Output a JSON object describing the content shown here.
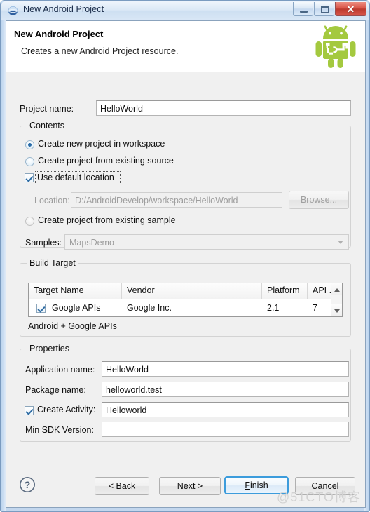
{
  "window": {
    "title": "New Android Project",
    "icon": "android-bubble-icon",
    "controls": {
      "minimize": "minimize-button",
      "restore": "restore-button",
      "close": "✕"
    }
  },
  "header": {
    "title": "New Android Project",
    "subtitle": "Creates a new Android Project resource.",
    "logo": "android-robot-logo",
    "logo_color": "#A4C93F"
  },
  "project_name": {
    "label": "Project name:",
    "value": "HelloWorld",
    "placeholder": ""
  },
  "contents": {
    "title": "Contents",
    "radio_new_workspace": {
      "label": "Create new project in workspace",
      "checked": true
    },
    "radio_existing_source": {
      "label": "Create project from existing source",
      "checked": false
    },
    "use_default_location": {
      "label": "Use default location",
      "checked": true,
      "focused": true
    },
    "location": {
      "label": "Location:",
      "value": "D:/AndroidDevelop/workspace/HelloWorld",
      "disabled": true
    },
    "browse_button": {
      "label": "Browse...",
      "disabled": true
    },
    "radio_existing_sample": {
      "label": "Create project from existing sample",
      "checked": false,
      "disabled": true
    },
    "samples": {
      "label": "Samples:",
      "value": "MapsDemo",
      "disabled": true
    }
  },
  "build_target": {
    "title": "Build Target",
    "columns": [
      "Target Name",
      "Vendor",
      "Platform",
      "API ..."
    ],
    "rows": [
      {
        "checked": true,
        "target_name": "Google APIs",
        "vendor": "Google Inc.",
        "platform": "2.1",
        "api_level": "7"
      }
    ],
    "description": "Android + Google APIs"
  },
  "properties": {
    "title": "Properties",
    "application_name": {
      "label": "Application name:",
      "value": "HelloWorld"
    },
    "package_name": {
      "label": "Package name:",
      "value": "helloworld.test"
    },
    "create_activity": {
      "label": "Create Activity:",
      "checked": true,
      "value": "Helloworld"
    },
    "min_sdk_version": {
      "label": "Min SDK Version:",
      "value": ""
    }
  },
  "footer": {
    "help_icon": "help-question-icon",
    "back_button": {
      "prefix": "< ",
      "mnemonic": "B",
      "suffix": "ack"
    },
    "next_button": {
      "prefix": "",
      "mnemonic": "N",
      "suffix": "ext >"
    },
    "finish_button": {
      "prefix": "",
      "mnemonic": "F",
      "suffix": "inish",
      "is_default": true
    },
    "cancel_button": {
      "label": "Cancel"
    },
    "watermark": "@51CTO博客"
  },
  "colors": {
    "dialog_bg": "#F0F0F0",
    "header_bg": "#FFFFFF",
    "accent_blue": "#3C9CDC",
    "android_green": "#A4C93F",
    "disabled_text": "#9D9D9D"
  }
}
